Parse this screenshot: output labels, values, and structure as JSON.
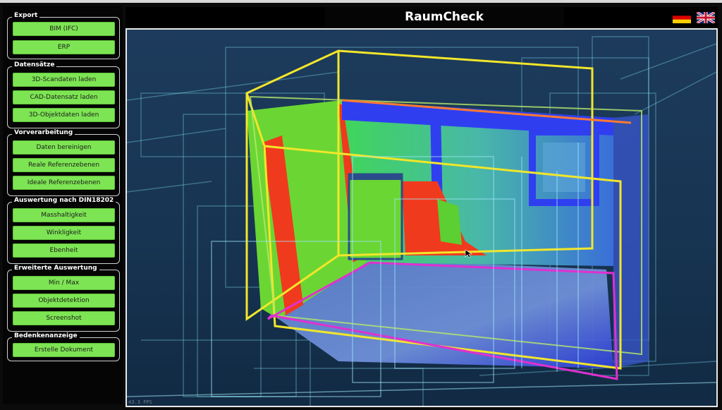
{
  "app": {
    "title": "RaumCheck"
  },
  "languages": [
    {
      "code": "de",
      "icon": "german-flag-icon"
    },
    {
      "code": "en",
      "icon": "uk-flag-icon"
    }
  ],
  "sidebar": {
    "groups": [
      {
        "title": "Export",
        "buttons": [
          "BIM (IFC)",
          "ERP"
        ]
      },
      {
        "title": "Datensätze",
        "buttons": [
          "3D-Scandaten laden",
          "CAD-Datensatz laden",
          "3D-Objektdaten laden"
        ]
      },
      {
        "title": "Vorverarbeitung",
        "buttons": [
          "Daten bereinigen",
          "Reale Referenzebenen",
          "Ideale Referenzebenen"
        ]
      },
      {
        "title": "Auswertung nach DIN18202",
        "buttons": [
          "Masshaltigkeit",
          "Winkligkeit",
          "Ebenheit"
        ]
      },
      {
        "title": "Erweiterte Auswertung",
        "buttons": [
          "Min / Max",
          "Objektdetektion",
          "Screenshot"
        ]
      },
      {
        "title": "Bedenkenanzeige",
        "buttons": [
          "Erstelle Dokument"
        ]
      }
    ]
  },
  "viewport": {
    "fps_label": "43.3 FPS"
  },
  "colors": {
    "button": "#7de553",
    "deviation_red": "#f03a1e",
    "deviation_green": "#7be02a",
    "deviation_blue": "#2f3ff0",
    "frame_yellow": "#f2e62a",
    "frame_magenta": "#e030d0",
    "wire_cyan": "#7fe0f0"
  }
}
